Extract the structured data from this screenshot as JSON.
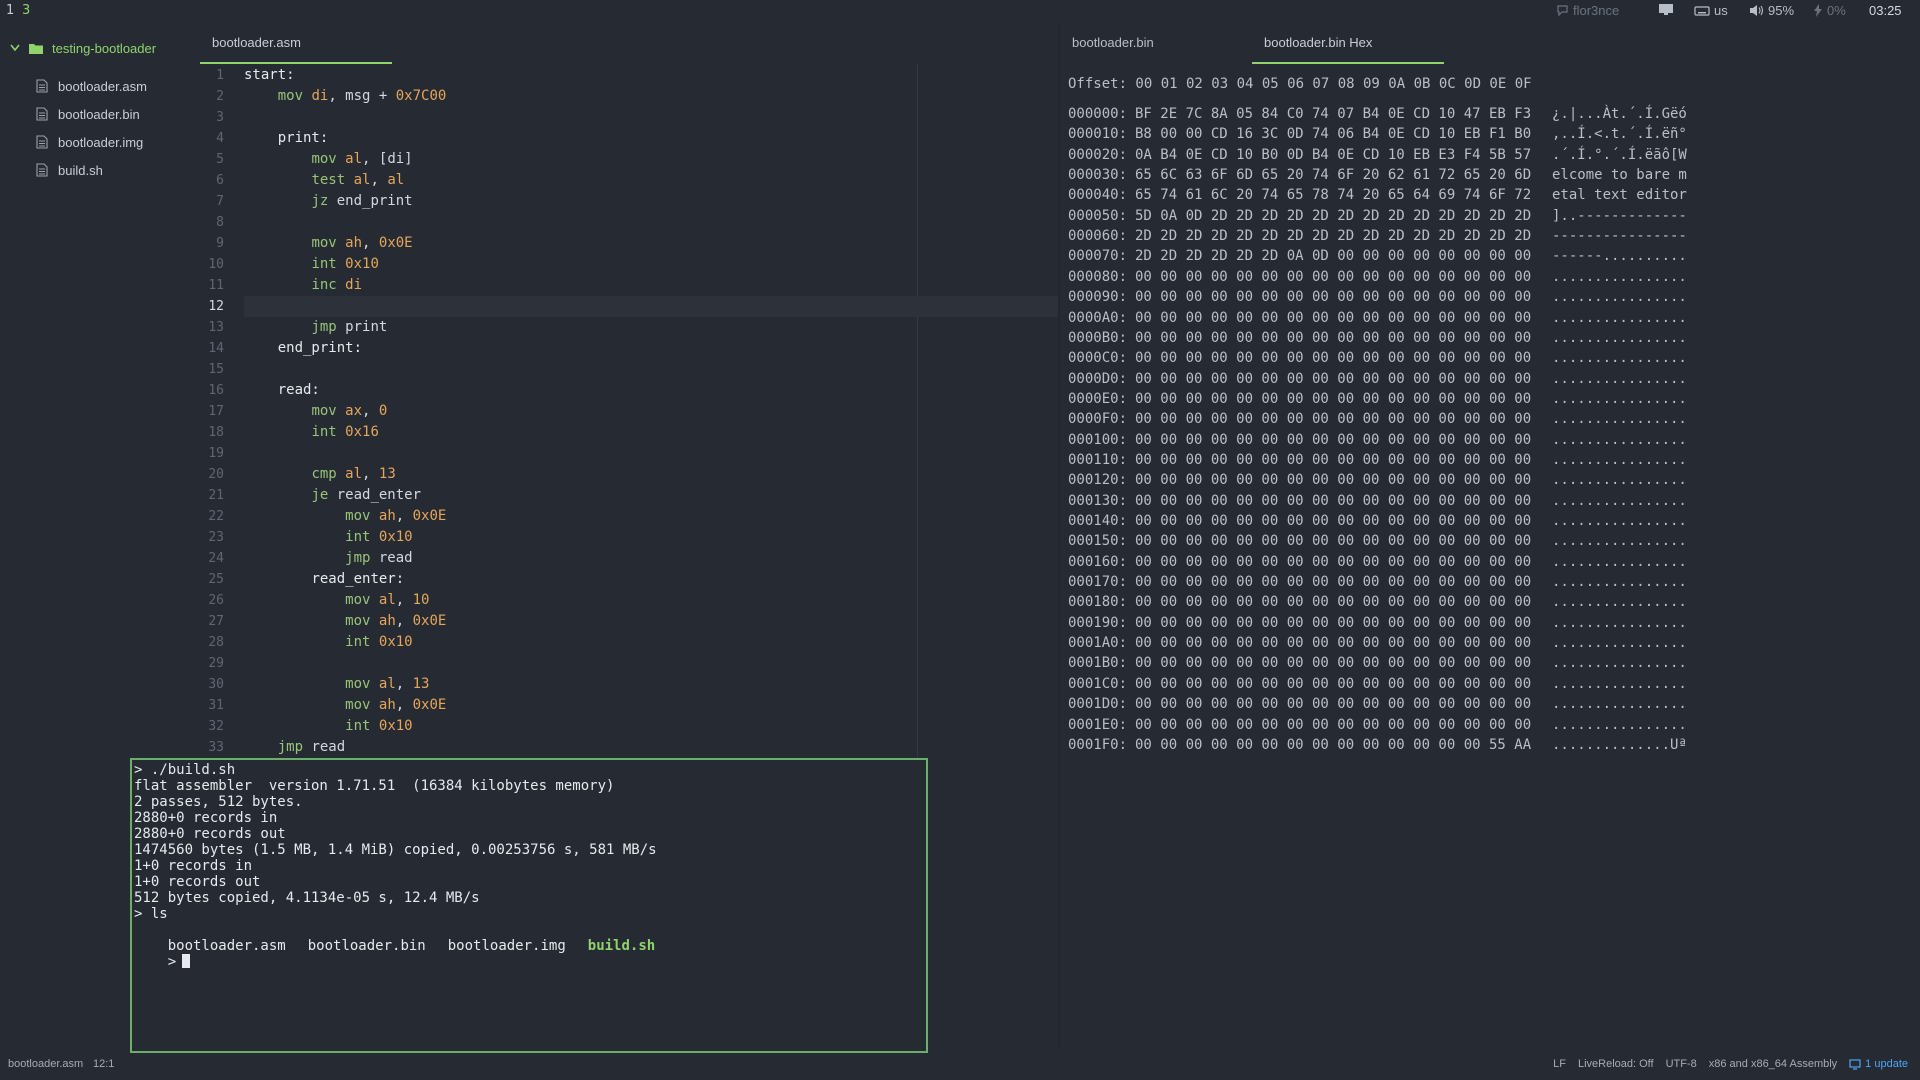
{
  "topbar": {
    "workspaces": [
      "1",
      "3"
    ],
    "user": "flor3nce",
    "keyboard": "us",
    "volume": "95%",
    "battery": "0%",
    "clock": "03:25"
  },
  "tree": {
    "project": "testing-bootloader",
    "files": [
      "bootloader.asm",
      "bootloader.bin",
      "bootloader.img",
      "build.sh"
    ]
  },
  "tabs": {
    "left": [
      "bootloader.asm"
    ],
    "right": [
      "bootloader.bin",
      "bootloader.bin Hex"
    ]
  },
  "editor": {
    "cursor_line": 12,
    "lines": [
      [
        [
          "label",
          "start:"
        ]
      ],
      [
        [
          "sp",
          "    "
        ],
        [
          "kw",
          "mov"
        ],
        [
          "sp",
          " "
        ],
        [
          "reg",
          "di"
        ],
        [
          "id",
          ", msg + "
        ],
        [
          "num",
          "0x7C00"
        ]
      ],
      [],
      [
        [
          "sp",
          "    "
        ],
        [
          "label",
          "print:"
        ]
      ],
      [
        [
          "sp",
          "        "
        ],
        [
          "kw",
          "mov"
        ],
        [
          "sp",
          " "
        ],
        [
          "reg",
          "al"
        ],
        [
          "id",
          ", [di]"
        ]
      ],
      [
        [
          "sp",
          "        "
        ],
        [
          "kw",
          "test"
        ],
        [
          "sp",
          " "
        ],
        [
          "reg",
          "al"
        ],
        [
          "id",
          ", "
        ],
        [
          "reg",
          "al"
        ]
      ],
      [
        [
          "sp",
          "        "
        ],
        [
          "kw",
          "jz"
        ],
        [
          "id",
          " end_print"
        ]
      ],
      [],
      [
        [
          "sp",
          "        "
        ],
        [
          "kw",
          "mov"
        ],
        [
          "sp",
          " "
        ],
        [
          "reg",
          "ah"
        ],
        [
          "id",
          ", "
        ],
        [
          "num",
          "0x0E"
        ]
      ],
      [
        [
          "sp",
          "        "
        ],
        [
          "kw",
          "int"
        ],
        [
          "sp",
          " "
        ],
        [
          "num",
          "0x10"
        ]
      ],
      [
        [
          "sp",
          "        "
        ],
        [
          "kw",
          "inc"
        ],
        [
          "sp",
          " "
        ],
        [
          "reg",
          "di"
        ]
      ],
      [],
      [
        [
          "sp",
          "        "
        ],
        [
          "kw",
          "jmp"
        ],
        [
          "id",
          " print"
        ]
      ],
      [
        [
          "sp",
          "    "
        ],
        [
          "label",
          "end_print:"
        ]
      ],
      [],
      [
        [
          "sp",
          "    "
        ],
        [
          "label",
          "read:"
        ]
      ],
      [
        [
          "sp",
          "        "
        ],
        [
          "kw",
          "mov"
        ],
        [
          "sp",
          " "
        ],
        [
          "reg",
          "ax"
        ],
        [
          "id",
          ", "
        ],
        [
          "num",
          "0"
        ]
      ],
      [
        [
          "sp",
          "        "
        ],
        [
          "kw",
          "int"
        ],
        [
          "sp",
          " "
        ],
        [
          "num",
          "0x16"
        ]
      ],
      [],
      [
        [
          "sp",
          "        "
        ],
        [
          "kw",
          "cmp"
        ],
        [
          "sp",
          " "
        ],
        [
          "reg",
          "al"
        ],
        [
          "id",
          ", "
        ],
        [
          "num",
          "13"
        ]
      ],
      [
        [
          "sp",
          "        "
        ],
        [
          "kw",
          "je"
        ],
        [
          "id",
          " read_enter"
        ]
      ],
      [
        [
          "sp",
          "            "
        ],
        [
          "kw",
          "mov"
        ],
        [
          "sp",
          " "
        ],
        [
          "reg",
          "ah"
        ],
        [
          "id",
          ", "
        ],
        [
          "num",
          "0x0E"
        ]
      ],
      [
        [
          "sp",
          "            "
        ],
        [
          "kw",
          "int"
        ],
        [
          "sp",
          " "
        ],
        [
          "num",
          "0x10"
        ]
      ],
      [
        [
          "sp",
          "            "
        ],
        [
          "kw",
          "jmp"
        ],
        [
          "id",
          " read"
        ]
      ],
      [
        [
          "sp",
          "        "
        ],
        [
          "label",
          "read_enter:"
        ]
      ],
      [
        [
          "sp",
          "            "
        ],
        [
          "kw",
          "mov"
        ],
        [
          "sp",
          " "
        ],
        [
          "reg",
          "al"
        ],
        [
          "id",
          ", "
        ],
        [
          "num",
          "10"
        ]
      ],
      [
        [
          "sp",
          "            "
        ],
        [
          "kw",
          "mov"
        ],
        [
          "sp",
          " "
        ],
        [
          "reg",
          "ah"
        ],
        [
          "id",
          ", "
        ],
        [
          "num",
          "0x0E"
        ]
      ],
      [
        [
          "sp",
          "            "
        ],
        [
          "kw",
          "int"
        ],
        [
          "sp",
          " "
        ],
        [
          "num",
          "0x10"
        ]
      ],
      [],
      [
        [
          "sp",
          "            "
        ],
        [
          "kw",
          "mov"
        ],
        [
          "sp",
          " "
        ],
        [
          "reg",
          "al"
        ],
        [
          "id",
          ", "
        ],
        [
          "num",
          "13"
        ]
      ],
      [
        [
          "sp",
          "            "
        ],
        [
          "kw",
          "mov"
        ],
        [
          "sp",
          " "
        ],
        [
          "reg",
          "ah"
        ],
        [
          "id",
          ", "
        ],
        [
          "num",
          "0x0E"
        ]
      ],
      [
        [
          "sp",
          "            "
        ],
        [
          "kw",
          "int"
        ],
        [
          "sp",
          " "
        ],
        [
          "num",
          "0x10"
        ]
      ],
      [
        [
          "sp",
          "    "
        ],
        [
          "kw",
          "jmp"
        ],
        [
          "id",
          " read"
        ]
      ]
    ]
  },
  "terminal": {
    "lines": [
      "> ./build.sh",
      "flat assembler  version 1.71.51  (16384 kilobytes memory)",
      "2 passes, 512 bytes.",
      "2880+0 records in",
      "2880+0 records out",
      "1474560 bytes (1.5 MB, 1.4 MiB) copied, 0.00253756 s, 581 MB/s",
      "1+0 records in",
      "1+0 records out",
      "512 bytes copied, 4.1134e-05 s, 12.4 MB/s",
      "> ls"
    ],
    "ls_output": [
      "bootloader.asm",
      "bootloader.bin",
      "bootloader.img"
    ],
    "ls_exec": "build.sh",
    "prompt": ">"
  },
  "hex": {
    "header": "Offset: 00 01 02 03 04 05 06 07 08 09 0A 0B 0C 0D 0E 0F",
    "rows": [
      [
        "000000:",
        "BF 2E 7C 8A 05 84 C0 74 07 B4 0E CD 10 47 EB F3",
        "¿.|...Àt.´.Í.Gëó"
      ],
      [
        "000010:",
        "B8 00 00 CD 16 3C 0D 74 06 B4 0E CD 10 EB F1 B0",
        ",..Í.<.t.´.Í.ëñ°"
      ],
      [
        "000020:",
        "0A B4 0E CD 10 B0 0D B4 0E CD 10 EB E3 F4 5B 57",
        ".´.Í.°.´.Í.ëãô[W"
      ],
      [
        "000030:",
        "65 6C 63 6F 6D 65 20 74 6F 20 62 61 72 65 20 6D",
        "elcome to bare m"
      ],
      [
        "000040:",
        "65 74 61 6C 20 74 65 78 74 20 65 64 69 74 6F 72",
        "etal text editor"
      ],
      [
        "000050:",
        "5D 0A 0D 2D 2D 2D 2D 2D 2D 2D 2D 2D 2D 2D 2D 2D",
        "]..-------------"
      ],
      [
        "000060:",
        "2D 2D 2D 2D 2D 2D 2D 2D 2D 2D 2D 2D 2D 2D 2D 2D",
        "----------------"
      ],
      [
        "000070:",
        "2D 2D 2D 2D 2D 2D 0A 0D 00 00 00 00 00 00 00 00",
        "------.........."
      ],
      [
        "000080:",
        "00 00 00 00 00 00 00 00 00 00 00 00 00 00 00 00",
        "................"
      ],
      [
        "000090:",
        "00 00 00 00 00 00 00 00 00 00 00 00 00 00 00 00",
        "................"
      ],
      [
        "0000A0:",
        "00 00 00 00 00 00 00 00 00 00 00 00 00 00 00 00",
        "................"
      ],
      [
        "0000B0:",
        "00 00 00 00 00 00 00 00 00 00 00 00 00 00 00 00",
        "................"
      ],
      [
        "0000C0:",
        "00 00 00 00 00 00 00 00 00 00 00 00 00 00 00 00",
        "................"
      ],
      [
        "0000D0:",
        "00 00 00 00 00 00 00 00 00 00 00 00 00 00 00 00",
        "................"
      ],
      [
        "0000E0:",
        "00 00 00 00 00 00 00 00 00 00 00 00 00 00 00 00",
        "................"
      ],
      [
        "0000F0:",
        "00 00 00 00 00 00 00 00 00 00 00 00 00 00 00 00",
        "................"
      ],
      [
        "000100:",
        "00 00 00 00 00 00 00 00 00 00 00 00 00 00 00 00",
        "................"
      ],
      [
        "000110:",
        "00 00 00 00 00 00 00 00 00 00 00 00 00 00 00 00",
        "................"
      ],
      [
        "000120:",
        "00 00 00 00 00 00 00 00 00 00 00 00 00 00 00 00",
        "................"
      ],
      [
        "000130:",
        "00 00 00 00 00 00 00 00 00 00 00 00 00 00 00 00",
        "................"
      ],
      [
        "000140:",
        "00 00 00 00 00 00 00 00 00 00 00 00 00 00 00 00",
        "................"
      ],
      [
        "000150:",
        "00 00 00 00 00 00 00 00 00 00 00 00 00 00 00 00",
        "................"
      ],
      [
        "000160:",
        "00 00 00 00 00 00 00 00 00 00 00 00 00 00 00 00",
        "................"
      ],
      [
        "000170:",
        "00 00 00 00 00 00 00 00 00 00 00 00 00 00 00 00",
        "................"
      ],
      [
        "000180:",
        "00 00 00 00 00 00 00 00 00 00 00 00 00 00 00 00",
        "................"
      ],
      [
        "000190:",
        "00 00 00 00 00 00 00 00 00 00 00 00 00 00 00 00",
        "................"
      ],
      [
        "0001A0:",
        "00 00 00 00 00 00 00 00 00 00 00 00 00 00 00 00",
        "................"
      ],
      [
        "0001B0:",
        "00 00 00 00 00 00 00 00 00 00 00 00 00 00 00 00",
        "................"
      ],
      [
        "0001C0:",
        "00 00 00 00 00 00 00 00 00 00 00 00 00 00 00 00",
        "................"
      ],
      [
        "0001D0:",
        "00 00 00 00 00 00 00 00 00 00 00 00 00 00 00 00",
        "................"
      ],
      [
        "0001E0:",
        "00 00 00 00 00 00 00 00 00 00 00 00 00 00 00 00",
        "................"
      ],
      [
        "0001F0:",
        "00 00 00 00 00 00 00 00 00 00 00 00 00 00 55 AA",
        "..............Uª"
      ]
    ]
  },
  "statusbar": {
    "file": "bootloader.asm",
    "cursor": "12:1",
    "line_ending": "LF",
    "livereload": "LiveReload: Off",
    "encoding": "UTF-8",
    "grammar": "x86 and x86_64 Assembly",
    "update": "1 update"
  },
  "colors": {
    "background": "#262b33",
    "accent": "#8fd36c",
    "terminal_border": "#6ab06a",
    "register": "#e5a55a",
    "instruction": "#98c379",
    "link": "#4fa3f7"
  }
}
